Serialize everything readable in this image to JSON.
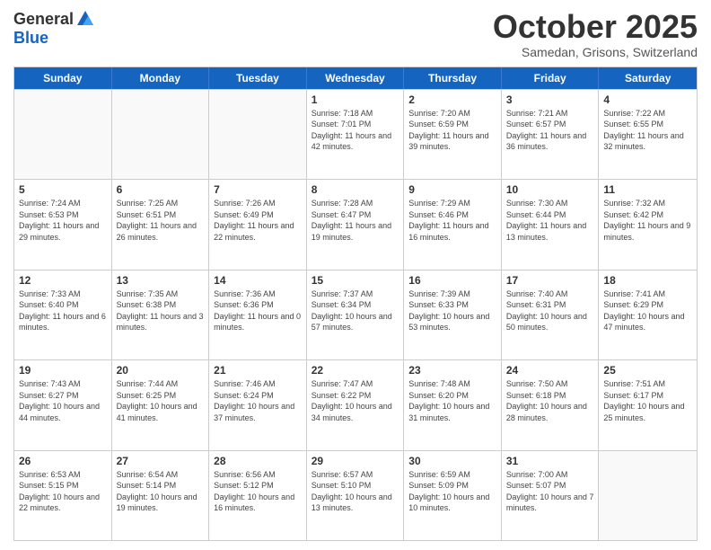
{
  "header": {
    "logo_general": "General",
    "logo_blue": "Blue",
    "month_title": "October 2025",
    "location": "Samedan, Grisons, Switzerland"
  },
  "days_of_week": [
    "Sunday",
    "Monday",
    "Tuesday",
    "Wednesday",
    "Thursday",
    "Friday",
    "Saturday"
  ],
  "rows": [
    [
      {
        "day": "",
        "text": ""
      },
      {
        "day": "",
        "text": ""
      },
      {
        "day": "",
        "text": ""
      },
      {
        "day": "1",
        "text": "Sunrise: 7:18 AM\nSunset: 7:01 PM\nDaylight: 11 hours and 42 minutes."
      },
      {
        "day": "2",
        "text": "Sunrise: 7:20 AM\nSunset: 6:59 PM\nDaylight: 11 hours and 39 minutes."
      },
      {
        "day": "3",
        "text": "Sunrise: 7:21 AM\nSunset: 6:57 PM\nDaylight: 11 hours and 36 minutes."
      },
      {
        "day": "4",
        "text": "Sunrise: 7:22 AM\nSunset: 6:55 PM\nDaylight: 11 hours and 32 minutes."
      }
    ],
    [
      {
        "day": "5",
        "text": "Sunrise: 7:24 AM\nSunset: 6:53 PM\nDaylight: 11 hours and 29 minutes."
      },
      {
        "day": "6",
        "text": "Sunrise: 7:25 AM\nSunset: 6:51 PM\nDaylight: 11 hours and 26 minutes."
      },
      {
        "day": "7",
        "text": "Sunrise: 7:26 AM\nSunset: 6:49 PM\nDaylight: 11 hours and 22 minutes."
      },
      {
        "day": "8",
        "text": "Sunrise: 7:28 AM\nSunset: 6:47 PM\nDaylight: 11 hours and 19 minutes."
      },
      {
        "day": "9",
        "text": "Sunrise: 7:29 AM\nSunset: 6:46 PM\nDaylight: 11 hours and 16 minutes."
      },
      {
        "day": "10",
        "text": "Sunrise: 7:30 AM\nSunset: 6:44 PM\nDaylight: 11 hours and 13 minutes."
      },
      {
        "day": "11",
        "text": "Sunrise: 7:32 AM\nSunset: 6:42 PM\nDaylight: 11 hours and 9 minutes."
      }
    ],
    [
      {
        "day": "12",
        "text": "Sunrise: 7:33 AM\nSunset: 6:40 PM\nDaylight: 11 hours and 6 minutes."
      },
      {
        "day": "13",
        "text": "Sunrise: 7:35 AM\nSunset: 6:38 PM\nDaylight: 11 hours and 3 minutes."
      },
      {
        "day": "14",
        "text": "Sunrise: 7:36 AM\nSunset: 6:36 PM\nDaylight: 11 hours and 0 minutes."
      },
      {
        "day": "15",
        "text": "Sunrise: 7:37 AM\nSunset: 6:34 PM\nDaylight: 10 hours and 57 minutes."
      },
      {
        "day": "16",
        "text": "Sunrise: 7:39 AM\nSunset: 6:33 PM\nDaylight: 10 hours and 53 minutes."
      },
      {
        "day": "17",
        "text": "Sunrise: 7:40 AM\nSunset: 6:31 PM\nDaylight: 10 hours and 50 minutes."
      },
      {
        "day": "18",
        "text": "Sunrise: 7:41 AM\nSunset: 6:29 PM\nDaylight: 10 hours and 47 minutes."
      }
    ],
    [
      {
        "day": "19",
        "text": "Sunrise: 7:43 AM\nSunset: 6:27 PM\nDaylight: 10 hours and 44 minutes."
      },
      {
        "day": "20",
        "text": "Sunrise: 7:44 AM\nSunset: 6:25 PM\nDaylight: 10 hours and 41 minutes."
      },
      {
        "day": "21",
        "text": "Sunrise: 7:46 AM\nSunset: 6:24 PM\nDaylight: 10 hours and 37 minutes."
      },
      {
        "day": "22",
        "text": "Sunrise: 7:47 AM\nSunset: 6:22 PM\nDaylight: 10 hours and 34 minutes."
      },
      {
        "day": "23",
        "text": "Sunrise: 7:48 AM\nSunset: 6:20 PM\nDaylight: 10 hours and 31 minutes."
      },
      {
        "day": "24",
        "text": "Sunrise: 7:50 AM\nSunset: 6:18 PM\nDaylight: 10 hours and 28 minutes."
      },
      {
        "day": "25",
        "text": "Sunrise: 7:51 AM\nSunset: 6:17 PM\nDaylight: 10 hours and 25 minutes."
      }
    ],
    [
      {
        "day": "26",
        "text": "Sunrise: 6:53 AM\nSunset: 5:15 PM\nDaylight: 10 hours and 22 minutes."
      },
      {
        "day": "27",
        "text": "Sunrise: 6:54 AM\nSunset: 5:14 PM\nDaylight: 10 hours and 19 minutes."
      },
      {
        "day": "28",
        "text": "Sunrise: 6:56 AM\nSunset: 5:12 PM\nDaylight: 10 hours and 16 minutes."
      },
      {
        "day": "29",
        "text": "Sunrise: 6:57 AM\nSunset: 5:10 PM\nDaylight: 10 hours and 13 minutes."
      },
      {
        "day": "30",
        "text": "Sunrise: 6:59 AM\nSunset: 5:09 PM\nDaylight: 10 hours and 10 minutes."
      },
      {
        "day": "31",
        "text": "Sunrise: 7:00 AM\nSunset: 5:07 PM\nDaylight: 10 hours and 7 minutes."
      },
      {
        "day": "",
        "text": ""
      }
    ]
  ]
}
